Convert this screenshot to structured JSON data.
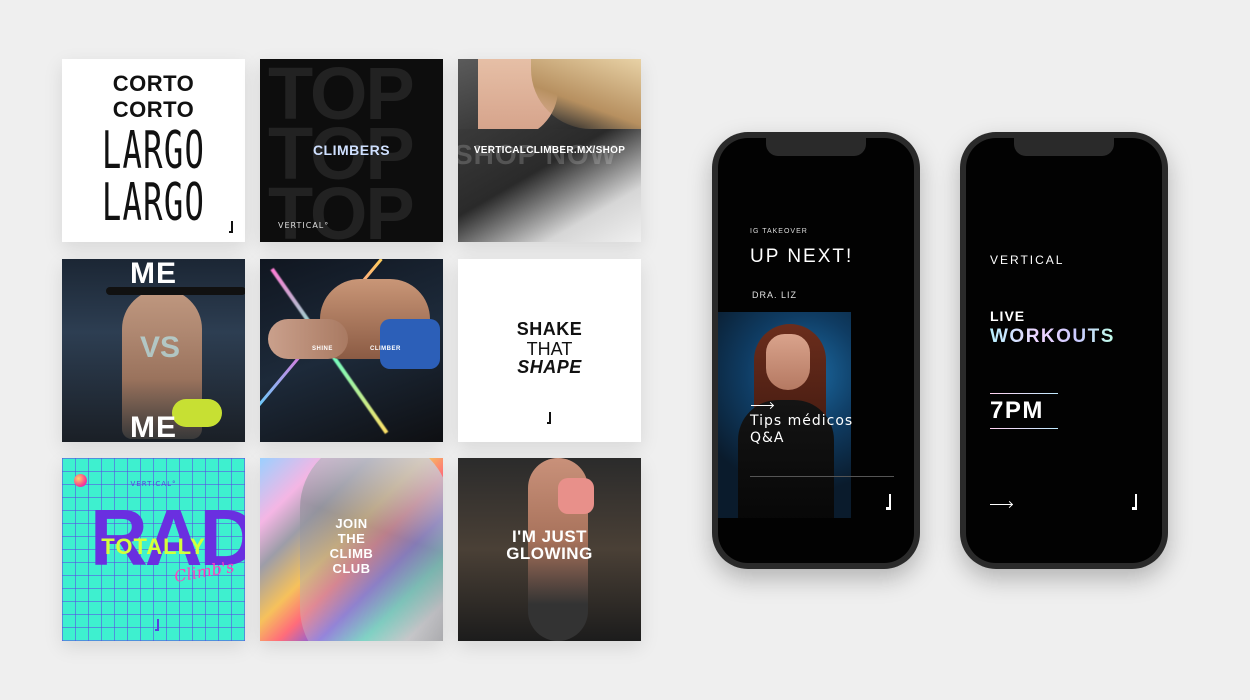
{
  "grid": {
    "tile1": {
      "lines": [
        "CORTO",
        "CORTO",
        "LARGO",
        "LARGO"
      ]
    },
    "tile2": {
      "bg_word": "TOP",
      "word": "CLIMBERS",
      "brand": "VERTICAL°"
    },
    "tile3": {
      "ghost": "SHOP NOW",
      "url": "VERTICALCLIMBER.MX/SHOP"
    },
    "tile4": {
      "top": "ME",
      "middle": "VS",
      "bottom": "ME"
    },
    "tile5": {
      "left": "SHINE",
      "right": "CLIMBER"
    },
    "tile6": {
      "lines": [
        "SHAKE",
        "THAT",
        "SHAPE"
      ]
    },
    "tile7": {
      "brand": "VERTICAL°",
      "big": "RAD",
      "overlay": "TOTALLY",
      "script": "Climb's"
    },
    "tile8": {
      "lines": [
        "JOIN",
        "THE",
        "CLIMB",
        "CLUB"
      ]
    },
    "tile9": {
      "lines": [
        "I'M JUST",
        "GLOWING"
      ]
    }
  },
  "phone1": {
    "kicker": "IG TAKEOVER",
    "headline": "UP NEXT!",
    "doctor": "DRA. LIZ",
    "tips_line1": "Tips médicos",
    "tips_line2": "Q&A"
  },
  "phone2": {
    "brand": "VERTICAL",
    "live": "LIVE",
    "workouts": "WORKOUTS",
    "time": "7PM"
  },
  "icons": {
    "brand_mark": "vertical-logo-mark-icon",
    "arrow": "arrow-right-icon"
  }
}
